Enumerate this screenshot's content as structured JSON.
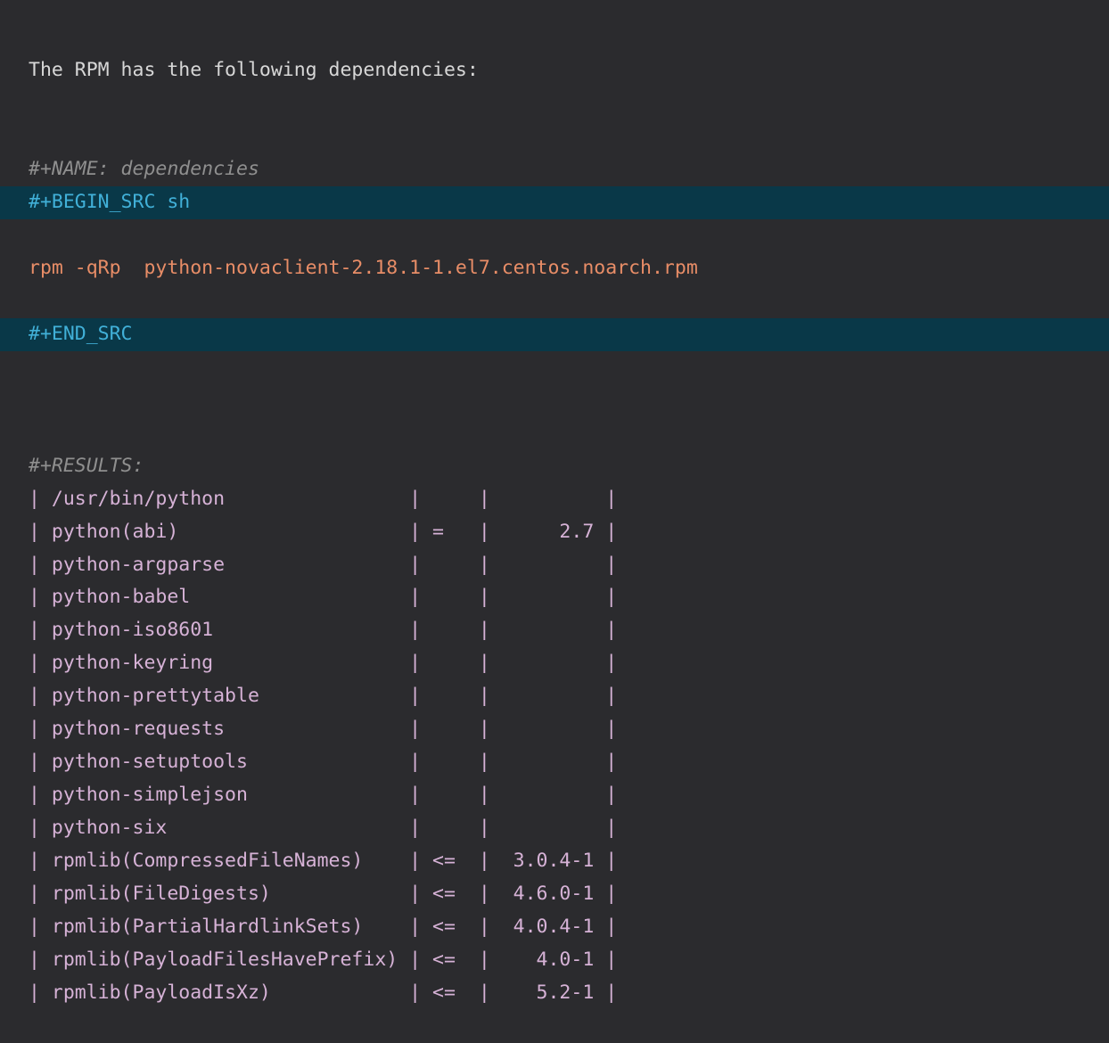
{
  "heading": "The RPM has the following dependencies:",
  "name_line": "#+NAME: dependencies",
  "begin_src": "#+BEGIN_SRC sh",
  "command": "rpm -qRp  python-novaclient-2.18.1-1.el7.centos.noarch.rpm",
  "end_src": "#+END_SRC",
  "results_label": "#+RESULTS:",
  "table": {
    "col_widths": {
      "name": 30,
      "op": 3,
      "ver": 8
    },
    "rows": [
      {
        "name": "/usr/bin/python",
        "op": "",
        "ver": ""
      },
      {
        "name": "python(abi)",
        "op": "=",
        "ver": "2.7"
      },
      {
        "name": "python-argparse",
        "op": "",
        "ver": ""
      },
      {
        "name": "python-babel",
        "op": "",
        "ver": ""
      },
      {
        "name": "python-iso8601",
        "op": "",
        "ver": ""
      },
      {
        "name": "python-keyring",
        "op": "",
        "ver": ""
      },
      {
        "name": "python-prettytable",
        "op": "",
        "ver": ""
      },
      {
        "name": "python-requests",
        "op": "",
        "ver": ""
      },
      {
        "name": "python-setuptools",
        "op": "",
        "ver": ""
      },
      {
        "name": "python-simplejson",
        "op": "",
        "ver": ""
      },
      {
        "name": "python-six",
        "op": "",
        "ver": ""
      },
      {
        "name": "rpmlib(CompressedFileNames)",
        "op": "<=",
        "ver": "3.0.4-1"
      },
      {
        "name": "rpmlib(FileDigests)",
        "op": "<=",
        "ver": "4.6.0-1"
      },
      {
        "name": "rpmlib(PartialHardlinkSets)",
        "op": "<=",
        "ver": "4.0.4-1"
      },
      {
        "name": "rpmlib(PayloadFilesHavePrefix)",
        "op": "<=",
        "ver": "4.0-1"
      },
      {
        "name": "rpmlib(PayloadIsXz)",
        "op": "<=",
        "ver": "5.2-1"
      }
    ]
  }
}
